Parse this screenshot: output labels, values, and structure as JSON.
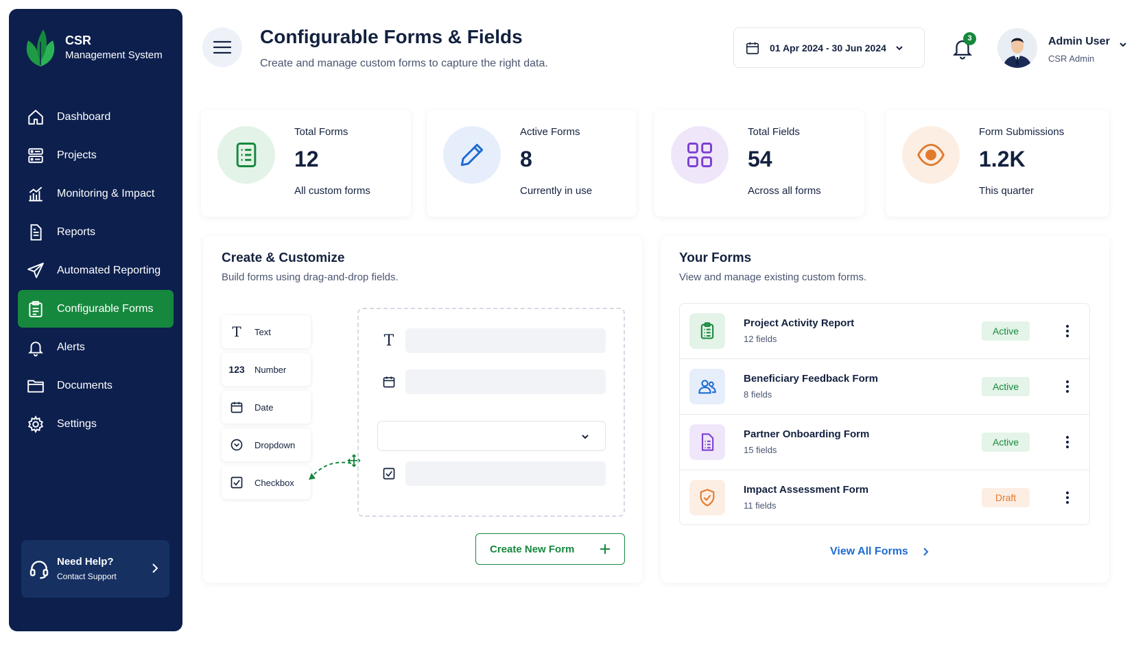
{
  "brand": {
    "title": "CSR",
    "subtitle": "Management System"
  },
  "sidebar": {
    "items": [
      {
        "label": "Dashboard",
        "icon": "home-icon"
      },
      {
        "label": "Projects",
        "icon": "projects-icon"
      },
      {
        "label": "Monitoring & Impact",
        "icon": "chart-icon"
      },
      {
        "label": "Reports",
        "icon": "report-icon"
      },
      {
        "label": "Automated Reporting",
        "icon": "send-icon"
      },
      {
        "label": "Configurable Forms",
        "icon": "clipboard-icon",
        "active": true
      },
      {
        "label": "Alerts",
        "icon": "bell-icon"
      },
      {
        "label": "Documents",
        "icon": "folder-icon"
      },
      {
        "label": "Settings",
        "icon": "gear-icon"
      }
    ],
    "help": {
      "title": "Need Help?",
      "subtitle": "Contact Support"
    }
  },
  "header": {
    "title": "Configurable Forms & Fields",
    "subtitle": "Create and manage custom forms to capture the right data.",
    "date_range": "01 Apr 2024 - 30 Jun 2024",
    "notifications": "3",
    "user": {
      "name": "Admin User",
      "role": "CSR Admin"
    }
  },
  "stats": [
    {
      "label": "Total Forms",
      "value": "12",
      "sub": "All custom forms",
      "icon": "form-icon"
    },
    {
      "label": "Active Forms",
      "value": "8",
      "sub": "Currently in use",
      "icon": "pencil-icon"
    },
    {
      "label": "Total Fields",
      "value": "54",
      "sub": "Across all forms",
      "icon": "grid-icon"
    },
    {
      "label": "Form Submissions",
      "value": "1.2K",
      "sub": "This quarter",
      "icon": "eye-icon"
    }
  ],
  "builder": {
    "title": "Create & Customize",
    "subtitle": "Build forms using drag-and-drop fields.",
    "field_types": [
      {
        "label": "Text",
        "icon": "text-icon",
        "glyph": "T"
      },
      {
        "label": "Number",
        "icon": "number-icon",
        "glyph": "123"
      },
      {
        "label": "Date",
        "icon": "calendar-icon"
      },
      {
        "label": "Dropdown",
        "icon": "dropdown-icon"
      },
      {
        "label": "Checkbox",
        "icon": "checkbox-icon"
      }
    ],
    "create_label": "Create New Form"
  },
  "forms": {
    "title": "Your Forms",
    "subtitle": "View and manage existing custom forms.",
    "items": [
      {
        "name": "Project Activity Report",
        "fields": "12 fields",
        "status": "Active",
        "icon": "clipboard-list-icon",
        "color": "#16883d"
      },
      {
        "name": "Beneficiary Feedback Form",
        "fields": "8 fields",
        "status": "Active",
        "icon": "users-icon",
        "color": "#1d6bd1"
      },
      {
        "name": "Partner Onboarding Form",
        "fields": "15 fields",
        "status": "Active",
        "icon": "document-icon",
        "color": "#7b3fd0"
      },
      {
        "name": "Impact Assessment Form",
        "fields": "11 fields",
        "status": "Draft",
        "icon": "shield-check-icon",
        "color": "#e07a2e"
      }
    ],
    "view_all": "View All Forms"
  },
  "colors": {
    "sidebar": "#0c1f4d",
    "accent": "#16883d",
    "link": "#1d6bd1",
    "draft": "#e07a2e"
  }
}
